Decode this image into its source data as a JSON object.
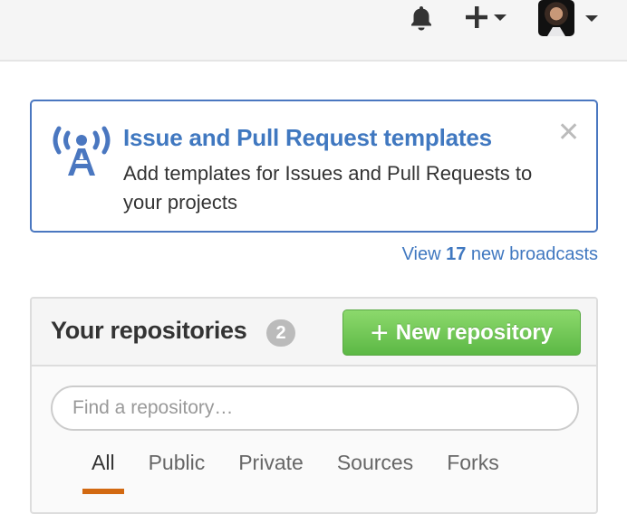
{
  "header": {
    "icons": [
      "bell-icon",
      "plus-icon",
      "avatar",
      "caret-down-icon"
    ],
    "avatar_alt": "User avatar"
  },
  "broadcast": {
    "icon": "broadcast-icon",
    "title": "Issue and Pull Request templates",
    "body": "Add templates for Issues and Pull Requests to your projects",
    "close_glyph": "✕",
    "accent_color": "#4078c0"
  },
  "broadcasts_link": {
    "prefix": "View ",
    "count": "17",
    "suffix": " new broadcasts"
  },
  "repositories": {
    "title": "Your repositories",
    "count": "2",
    "new_button_glyph": "+",
    "new_button_label": "New repository",
    "search_placeholder": "Find a repository…",
    "tabs": [
      {
        "label": "All",
        "active": true
      },
      {
        "label": "Public",
        "active": false
      },
      {
        "label": "Private",
        "active": false
      },
      {
        "label": "Sources",
        "active": false
      },
      {
        "label": "Forks",
        "active": false
      }
    ],
    "active_tab_color": "#d26911",
    "button_color": "#6cc644"
  }
}
